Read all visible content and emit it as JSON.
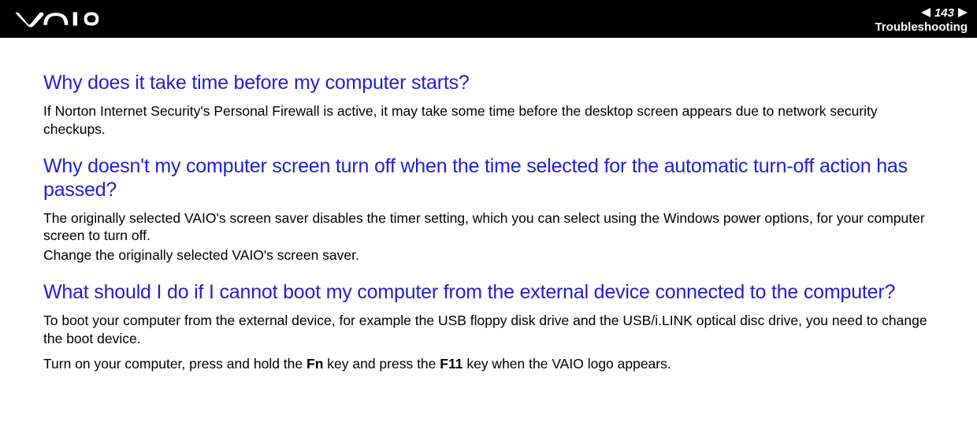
{
  "header": {
    "page_number": "143",
    "section_title": "Troubleshooting"
  },
  "content": {
    "q1": {
      "question": "Why does it take time before my computer starts?",
      "answer": "If Norton Internet Security's Personal Firewall is active, it may take some time before the desktop screen appears due to network security checkups."
    },
    "q2": {
      "question": "Why doesn't my computer screen turn off when the time selected for the automatic turn-off action has passed?",
      "answer_p1": "The originally selected VAIO's screen saver disables the timer setting, which you can select using the Windows power options, for your computer screen to turn off.",
      "answer_p2": "Change the originally selected VAIO's screen saver."
    },
    "q3": {
      "question": "What should I do if I cannot boot my computer from the external device connected to the computer?",
      "answer_p1": "To boot your computer from the external device, for example the USB floppy disk drive and the USB/i.LINK optical disc drive, you need to change the boot device.",
      "answer_p2_a": "Turn on your computer, press and hold the ",
      "answer_p2_fn": "Fn",
      "answer_p2_b": " key and press the ",
      "answer_p2_f11": "F11",
      "answer_p2_c": " key when the VAIO logo appears."
    }
  }
}
